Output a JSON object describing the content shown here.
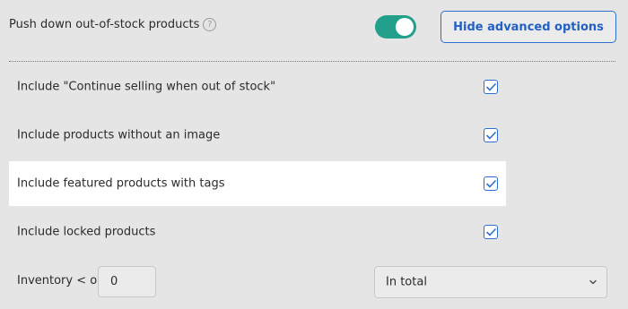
{
  "header": {
    "push_down_label": "Push down out-of-stock products",
    "help_icon": "question-circle-icon",
    "toggle_on": true,
    "advanced_button_label": "Hide advanced options"
  },
  "options": [
    {
      "label": "Include \"Continue selling when out of stock\"",
      "checked": true
    },
    {
      "label": "Include products without an image",
      "checked": true
    },
    {
      "label": "Include featured products with tags",
      "checked": true
    },
    {
      "label": "Include locked products",
      "checked": true
    }
  ],
  "inventory": {
    "label": "Inventory < or=",
    "value": "0",
    "select_value": "In total"
  },
  "colors": {
    "accent": "#2d6fd0",
    "toggle": "#23a08c"
  }
}
